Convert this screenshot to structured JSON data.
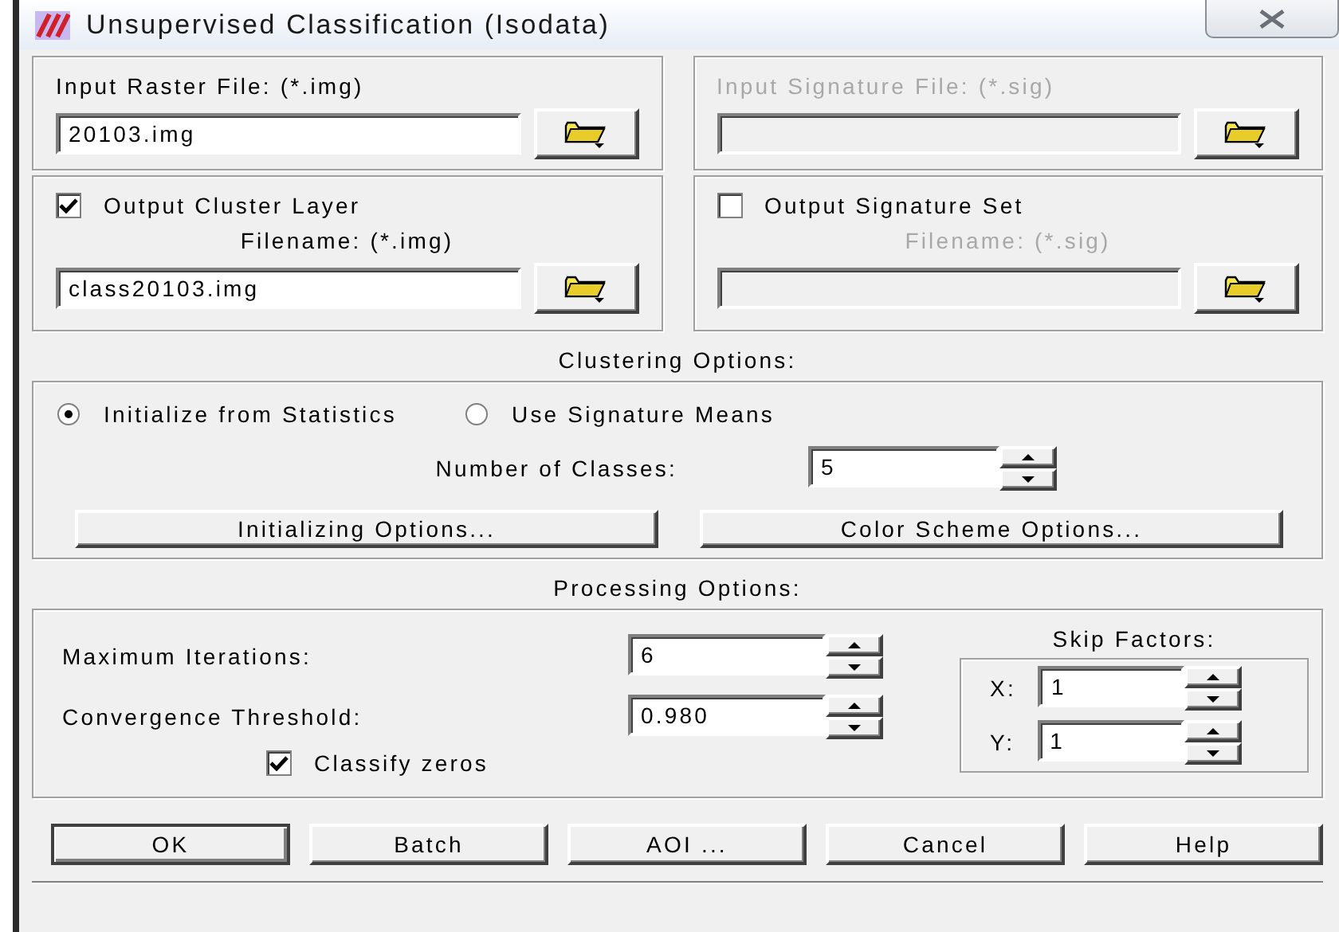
{
  "window": {
    "title": "Unsupervised Classification (Isodata)"
  },
  "file_panels": [
    {
      "kind": "file",
      "label": "Input Raster File: (*.img)",
      "value": "20103.img",
      "disabled": false
    },
    {
      "kind": "file",
      "label": "Input Signature File: (*.sig)",
      "disabled": true
    },
    {
      "kind": "output",
      "label": "Output Cluster Layer",
      "checked": true,
      "filename_label": "Filename: (*.img)",
      "value": "class20103.img",
      "disabled": false
    },
    {
      "kind": "output",
      "label": "Output Signature Set",
      "checked": false,
      "filename_label": "Filename: (*.sig)",
      "disabled": true
    }
  ],
  "clustering": {
    "title": "Clustering Options:",
    "options": [
      {
        "label": "Initialize from Statistics",
        "selected": true
      },
      {
        "label": "Use Signature Means",
        "selected": false
      }
    ],
    "classes": {
      "label": "Number of Classes:",
      "value": "5"
    },
    "buttons": [
      "Initializing Options...",
      "Color Scheme Options..."
    ]
  },
  "processing": {
    "title": "Processing Options:",
    "max_iterations": {
      "label": "Maximum Iterations:",
      "value": "6"
    },
    "convergence": {
      "label": "Convergence Threshold:",
      "value": "0.980"
    },
    "classify_zeros": {
      "label": "Classify zeros",
      "checked": true
    },
    "skip_factors": {
      "title": "Skip Factors:",
      "x": {
        "label": "X:",
        "value": "1"
      },
      "y": {
        "label": "Y:",
        "value": "1"
      }
    }
  },
  "buttons": [
    {
      "label": "OK",
      "default": true
    },
    {
      "label": "Batch",
      "default": false
    },
    {
      "label": "AOI ...",
      "default": false
    },
    {
      "label": "Cancel",
      "default": false
    },
    {
      "label": "Help",
      "default": false
    }
  ]
}
